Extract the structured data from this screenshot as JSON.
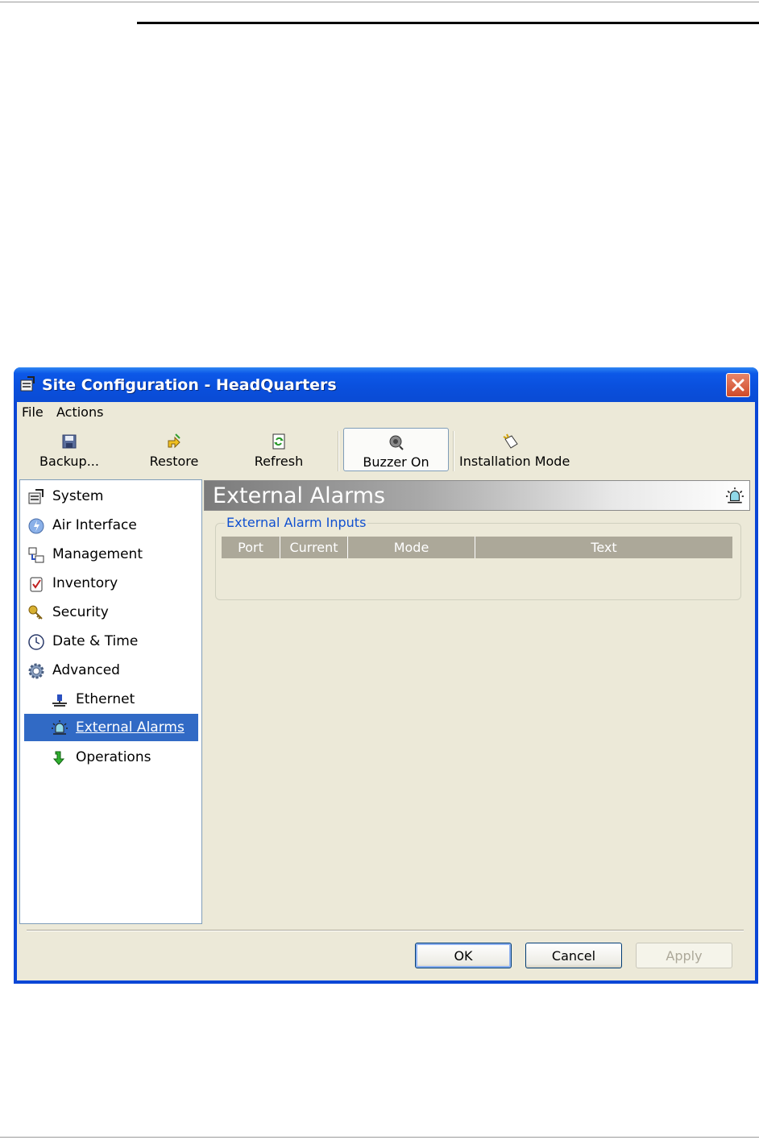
{
  "window": {
    "title": "Site Configuration - HeadQuarters"
  },
  "menu": [
    "File",
    "Actions"
  ],
  "toolbar": {
    "backup": "Backup...",
    "restore": "Restore",
    "refresh": "Refresh",
    "buzzer": "Buzzer On",
    "installation": "Installation Mode"
  },
  "sidebar": {
    "items": [
      {
        "label": "System",
        "icon": "system-icon"
      },
      {
        "label": "Air Interface",
        "icon": "air-interface-icon"
      },
      {
        "label": "Management",
        "icon": "management-icon"
      },
      {
        "label": "Inventory",
        "icon": "inventory-icon"
      },
      {
        "label": "Security",
        "icon": "security-icon"
      },
      {
        "label": "Date & Time",
        "icon": "clock-icon"
      },
      {
        "label": "Advanced",
        "icon": "gear-icon"
      },
      {
        "label": "Ethernet",
        "icon": "ethernet-icon"
      },
      {
        "label": "External Alarms",
        "icon": "alarm-icon",
        "selected": true
      },
      {
        "label": "Operations",
        "icon": "arrow-down-icon"
      }
    ]
  },
  "content": {
    "title": "External Alarms",
    "group_title": "External Alarm Inputs",
    "columns": [
      "Port",
      "Current",
      "Mode",
      "Text"
    ],
    "rows": []
  },
  "buttons": {
    "ok": "OK",
    "cancel": "Cancel",
    "apply": "Apply"
  },
  "colors": {
    "selection": "#316ac5",
    "titlebar": "#0a4fdc",
    "dialog_bg": "#ece9d8",
    "group_title": "#1050d0"
  }
}
